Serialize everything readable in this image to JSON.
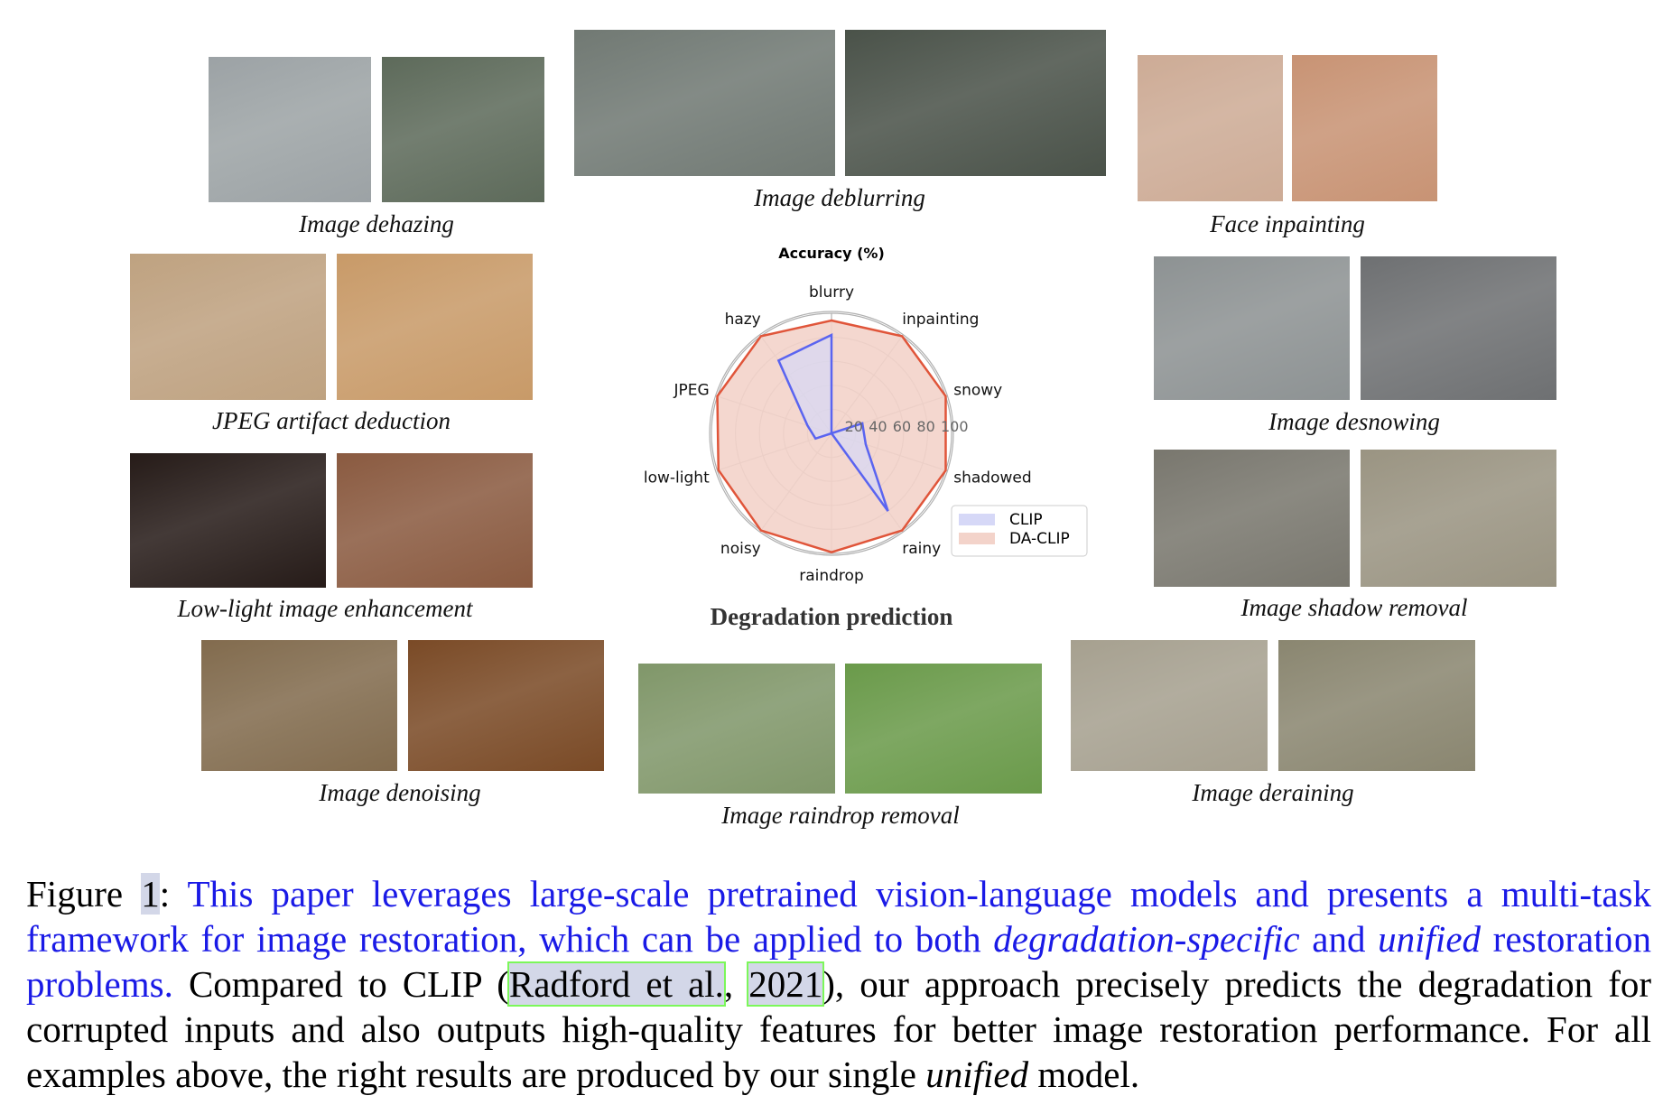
{
  "panels": [
    {
      "caption": "Image dehazing",
      "colors": [
        "#9aa3a6",
        "#5d6a5a"
      ]
    },
    {
      "caption": "Image deblurring",
      "colors": [
        "#6e7a72",
        "#4a5249"
      ]
    },
    {
      "caption": "Face inpainting",
      "colors": [
        "#d9a98a",
        "#c89374"
      ]
    },
    {
      "caption": "JPEG artifact deduction",
      "colors": [
        "#c9a070",
        "#c89a68"
      ]
    },
    {
      "caption": "Low-light image enhancement",
      "colors": [
        "#2a1a16",
        "#8a5a40"
      ]
    },
    {
      "caption": "Image denoising",
      "colors": [
        "#8a6a40",
        "#7a4a26"
      ]
    },
    {
      "caption": "Image raindrop removal",
      "colors": [
        "#7a9a5a",
        "#6a9a4a"
      ]
    },
    {
      "caption": "Image deraining",
      "colors": [
        "#a8a088",
        "#8a8670"
      ]
    },
    {
      "caption": "Image desnowing",
      "colors": [
        "#8c9294",
        "#6e7072"
      ]
    },
    {
      "caption": "Image shadow removal",
      "colors": [
        "#7a776a",
        "#9a9482"
      ]
    }
  ],
  "chart_data": {
    "type": "radar",
    "title": "Accuracy (%)",
    "subtitle": "Degradation prediction",
    "categories": [
      "blurry",
      "inpainting",
      "snowy",
      "shadowed",
      "rainy",
      "raindrop",
      "noisy",
      "low-light",
      "JPEG",
      "hazy"
    ],
    "radial_ticks": [
      20,
      40,
      60,
      80,
      100
    ],
    "rlim": [
      0,
      100
    ],
    "grid": true,
    "legend_placement": "lower-right",
    "series": [
      {
        "name": "CLIP",
        "values": [
          82,
          0,
          27,
          30,
          80,
          0,
          0,
          14,
          21,
          75
        ],
        "line_color": "#5a64f0",
        "fill_color": "#d6d8f7"
      },
      {
        "name": "DA-CLIP",
        "values": [
          94,
          100,
          100,
          100,
          100,
          99,
          100,
          99,
          100,
          100
        ],
        "line_color": "#e0553a",
        "fill_color": "#f3d3ca"
      }
    ]
  },
  "caption": {
    "figure_label": "Figure ",
    "figure_number": "1",
    "colon": ": ",
    "blue_part1": "This paper leverages large-scale pretrained vision-language models and presents a multi-task framework for image restoration, which can be applied to both ",
    "blue_italic1": "degradation-specific",
    "blue_part2": " and ",
    "blue_italic2": "unified",
    "blue_part3": " restoration problems.",
    "text1": " Compared to CLIP (",
    "ref_authors": "Radford et al.",
    "ref_sep": ", ",
    "ref_year": "2021",
    "text2": "), our approach precisely predicts the degradation for corrupted inputs and also outputs high-quality features for better image restoration performance. For all examples above, the right results are produced by our single ",
    "italic": "unified",
    "text3": " model."
  }
}
